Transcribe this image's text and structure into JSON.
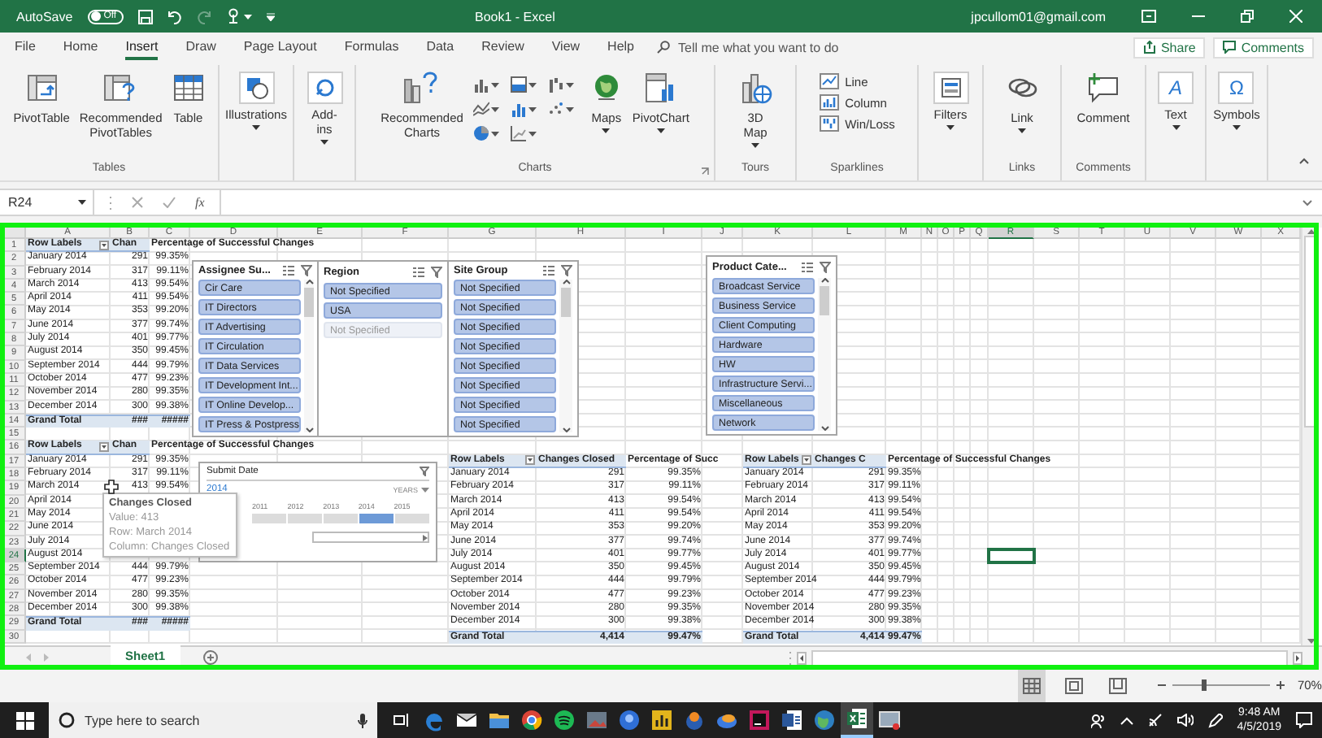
{
  "title_bar": {
    "autosave_label": "AutoSave",
    "autosave": {
      "label": "Off",
      "on": false
    },
    "quick_access": [
      {
        "kind": "save",
        "disabled": false
      },
      {
        "kind": "undo",
        "disabled": false
      },
      {
        "kind": "redo",
        "disabled": true
      },
      {
        "kind": "touch",
        "disabled": false
      }
    ],
    "title": "Book1 - Excel",
    "account": "jpcullom01@gmail.com"
  },
  "ribbon_tabs": [
    {
      "label": "File",
      "selected": false
    },
    {
      "label": "Home",
      "selected": false
    },
    {
      "label": "Insert",
      "selected": true
    },
    {
      "label": "Draw",
      "selected": false
    },
    {
      "label": "Page Layout",
      "selected": false
    },
    {
      "label": "Formulas",
      "selected": false
    },
    {
      "label": "Data",
      "selected": false
    },
    {
      "label": "Review",
      "selected": false
    },
    {
      "label": "View",
      "selected": false
    },
    {
      "label": "Help",
      "selected": false
    }
  ],
  "tell_me": {
    "placeholder": "Tell me what you want to do"
  },
  "share_button": "Share",
  "comments_button": "Comments",
  "ribbon_groups": [
    {
      "label": "Tables",
      "buttons": [
        {
          "kind": "pivottable",
          "label": "PivotTable"
        },
        {
          "kind": "recommended-pivot",
          "label": "Recommended PivotTables"
        },
        {
          "kind": "table",
          "label": "Table"
        }
      ]
    },
    {
      "buttons": [
        {
          "kind": "illustrations",
          "label": "Illustrations",
          "dropdown": true
        }
      ]
    },
    {
      "buttons": [
        {
          "kind": "addins",
          "label": "Add-ins",
          "dropdown": true
        }
      ]
    },
    {
      "label": "Charts",
      "launcher": true,
      "buttons": [
        {
          "kind": "recommended-charts",
          "label": "Recommended Charts"
        },
        {
          "kind": "chart-gallery"
        },
        {
          "kind": "maps",
          "label": "Maps",
          "dropdown": true
        },
        {
          "kind": "pivotchart",
          "label": "PivotChart",
          "dropdown": true
        }
      ]
    },
    {
      "label": "Tours",
      "buttons": [
        {
          "kind": "tours",
          "label": "3D Map",
          "dropdown": true
        }
      ]
    },
    {
      "label": "Sparklines",
      "buttons": [
        {
          "kind": "sparklines",
          "items": [
            {
              "kind": "line",
              "label": "Line"
            },
            {
              "kind": "column",
              "label": "Column"
            },
            {
              "kind": "winloss",
              "label": "Win/Loss"
            }
          ]
        }
      ]
    },
    {
      "buttons": [
        {
          "kind": "filters",
          "label": "Filters",
          "dropdown": true
        }
      ]
    },
    {
      "label": "Links",
      "buttons": [
        {
          "kind": "link",
          "label": "Link",
          "dropdown": true
        }
      ]
    },
    {
      "label": "Comments",
      "buttons": [
        {
          "kind": "comment",
          "label": "Comment"
        }
      ]
    },
    {
      "buttons": [
        {
          "kind": "text",
          "glyph": "A",
          "label": "Text",
          "dropdown": true
        }
      ]
    },
    {
      "buttons": [
        {
          "kind": "symbols",
          "glyph": "Ω",
          "label": "Symbols",
          "dropdown": true
        }
      ]
    }
  ],
  "formula_bar": {
    "name_box": "R24",
    "function_label": "fx"
  },
  "sheet": {
    "columns": [
      {
        "letter": "A",
        "selected": false
      },
      {
        "letter": "B",
        "selected": false
      },
      {
        "letter": "C",
        "selected": false
      },
      {
        "letter": "D",
        "selected": false
      },
      {
        "letter": "E",
        "selected": false
      },
      {
        "letter": "F",
        "selected": false
      },
      {
        "letter": "G",
        "selected": false
      },
      {
        "letter": "H",
        "selected": false
      },
      {
        "letter": "I",
        "selected": false
      },
      {
        "letter": "J",
        "selected": false
      },
      {
        "letter": "K",
        "selected": false
      },
      {
        "letter": "L",
        "selected": false
      },
      {
        "letter": "M",
        "selected": false
      },
      {
        "letter": "N",
        "selected": false
      },
      {
        "letter": "O",
        "selected": false
      },
      {
        "letter": "P",
        "selected": false
      },
      {
        "letter": "Q",
        "selected": false
      },
      {
        "letter": "R",
        "selected": true
      },
      {
        "letter": "S",
        "selected": false
      },
      {
        "letter": "T",
        "selected": false
      },
      {
        "letter": "U",
        "selected": false
      },
      {
        "letter": "V",
        "selected": false
      },
      {
        "letter": "W",
        "selected": false
      },
      {
        "letter": "X",
        "selected": false
      }
    ],
    "rows": [
      {
        "number": "1",
        "selected": false
      },
      {
        "number": "2",
        "selected": false
      },
      {
        "number": "3",
        "selected": false
      },
      {
        "number": "4",
        "selected": false
      },
      {
        "number": "5",
        "selected": false
      },
      {
        "number": "6",
        "selected": false
      },
      {
        "number": "7",
        "selected": false
      },
      {
        "number": "8",
        "selected": false
      },
      {
        "number": "9",
        "selected": false
      },
      {
        "number": "10",
        "selected": false
      },
      {
        "number": "11",
        "selected": false
      },
      {
        "number": "12",
        "selected": false
      },
      {
        "number": "13",
        "selected": false
      },
      {
        "number": "14",
        "selected": false
      },
      {
        "number": "15",
        "selected": false
      },
      {
        "number": "16",
        "selected": false
      },
      {
        "number": "17",
        "selected": false
      },
      {
        "number": "18",
        "selected": false
      },
      {
        "number": "19",
        "selected": false
      },
      {
        "number": "20",
        "selected": false
      },
      {
        "number": "21",
        "selected": false
      },
      {
        "number": "22",
        "selected": false
      },
      {
        "number": "23",
        "selected": false
      },
      {
        "number": "24",
        "selected": true
      },
      {
        "number": "25",
        "selected": false
      },
      {
        "number": "26",
        "selected": false
      },
      {
        "number": "27",
        "selected": false
      },
      {
        "number": "28",
        "selected": false
      },
      {
        "number": "29",
        "selected": false
      },
      {
        "number": "30",
        "selected": false
      }
    ]
  },
  "pivot_tables": [
    {
      "headers": [
        "Row Labels",
        "Chan",
        "Percentage of Successful Changes"
      ],
      "rows": [
        {
          "label": "January 2014",
          "count": "291",
          "percent": "99.35%"
        },
        {
          "label": "February 2014",
          "count": "317",
          "percent": "99.11%"
        },
        {
          "label": "March 2014",
          "count": "413",
          "percent": "99.54%"
        },
        {
          "label": "April 2014",
          "count": "411",
          "percent": "99.54%"
        },
        {
          "label": "May 2014",
          "count": "353",
          "percent": "99.20%"
        },
        {
          "label": "June 2014",
          "count": "377",
          "percent": "99.74%"
        },
        {
          "label": "July 2014",
          "count": "401",
          "percent": "99.77%"
        },
        {
          "label": "August 2014",
          "count": "350",
          "percent": "99.45%"
        },
        {
          "label": "September 2014",
          "count": "444",
          "percent": "99.79%"
        },
        {
          "label": "October 2014",
          "count": "477",
          "percent": "99.23%"
        },
        {
          "label": "November 2014",
          "count": "280",
          "percent": "99.35%"
        },
        {
          "label": "December 2014",
          "count": "300",
          "percent": "99.38%"
        }
      ],
      "total": {
        "label": "Grand Total",
        "count": "###",
        "percent": "#####"
      }
    },
    {
      "headers": [
        "Row Labels",
        "Chan",
        "Percentage of Successful Changes"
      ],
      "rows": [
        {
          "label": "January 2014",
          "count": "291",
          "percent": "99.35%"
        },
        {
          "label": "February 2014",
          "count": "317",
          "percent": "99.11%"
        },
        {
          "label": "March 2014",
          "count": "413",
          "percent": "99.54%"
        },
        {
          "label": "April 2014"
        },
        {
          "label": "May 2014"
        },
        {
          "label": "June 2014"
        },
        {
          "label": "July 2014"
        },
        {
          "label": "August 2014"
        },
        {
          "label": "September 2014",
          "count": "444",
          "percent": "99.79%"
        },
        {
          "label": "October 2014",
          "count": "477",
          "percent": "99.23%"
        },
        {
          "label": "November 2014",
          "count": "280",
          "percent": "99.35%"
        },
        {
          "label": "December 2014",
          "count": "300",
          "percent": "99.38%"
        }
      ],
      "total": {
        "label": "Grand Total",
        "count": "###",
        "percent": "#####"
      }
    },
    {
      "headers": [
        "Row Labels",
        "Changes Closed",
        "Percentage of Succ"
      ],
      "rows": [
        {
          "label": "January 2014",
          "count": "291",
          "percent": "99.35%"
        },
        {
          "label": "February 2014",
          "count": "317",
          "percent": "99.11%"
        },
        {
          "label": "March 2014",
          "count": "413",
          "percent": "99.54%"
        },
        {
          "label": "April 2014",
          "count": "411",
          "percent": "99.54%"
        },
        {
          "label": "May 2014",
          "count": "353",
          "percent": "99.20%"
        },
        {
          "label": "June 2014",
          "count": "377",
          "percent": "99.74%"
        },
        {
          "label": "July 2014",
          "count": "401",
          "percent": "99.77%"
        },
        {
          "label": "August 2014",
          "count": "350",
          "percent": "99.45%"
        },
        {
          "label": "September 2014",
          "count": "444",
          "percent": "99.79%"
        },
        {
          "label": "October 2014",
          "count": "477",
          "percent": "99.23%"
        },
        {
          "label": "November 2014",
          "count": "280",
          "percent": "99.35%"
        },
        {
          "label": "December 2014",
          "count": "300",
          "percent": "99.38%"
        }
      ],
      "total": {
        "label": "Grand Total",
        "count": "4,414",
        "percent": "99.47%"
      }
    },
    {
      "headers": [
        "Row Labels",
        "Changes C",
        "Percentage of Successful Changes"
      ],
      "rows": [
        {
          "label": "January 2014",
          "count": "291",
          "percent": "99.35%"
        },
        {
          "label": "February 2014",
          "count": "317",
          "percent": "99.11%"
        },
        {
          "label": "March 2014",
          "count": "413",
          "percent": "99.54%"
        },
        {
          "label": "April 2014",
          "count": "411",
          "percent": "99.54%"
        },
        {
          "label": "May 2014",
          "count": "353",
          "percent": "99.20%"
        },
        {
          "label": "June 2014",
          "count": "377",
          "percent": "99.74%"
        },
        {
          "label": "July 2014",
          "count": "401",
          "percent": "99.77%"
        },
        {
          "label": "August 2014",
          "count": "350",
          "percent": "99.45%"
        },
        {
          "label": "September 2014",
          "count": "444",
          "percent": "99.79%"
        },
        {
          "label": "October 2014",
          "count": "477",
          "percent": "99.23%"
        },
        {
          "label": "November 2014",
          "count": "280",
          "percent": "99.35%"
        },
        {
          "label": "December 2014",
          "count": "300",
          "percent": "99.38%"
        }
      ],
      "total": {
        "label": "Grand Total",
        "count": "4,414",
        "percent": "99.47%"
      }
    }
  ],
  "slicers": [
    {
      "title": "Assignee Su...",
      "scrollbar": true,
      "items": [
        {
          "label": "Cir Care",
          "selected": true
        },
        {
          "label": "IT Directors",
          "selected": true
        },
        {
          "label": "IT Advertising",
          "selected": true
        },
        {
          "label": "IT Circulation",
          "selected": true
        },
        {
          "label": "IT Data Services",
          "selected": true
        },
        {
          "label": "IT Development Int...",
          "selected": true
        },
        {
          "label": "IT Online Develop...",
          "selected": true
        },
        {
          "label": "IT Press & Postpress",
          "selected": true
        }
      ]
    },
    {
      "title": "Region",
      "scrollbar": false,
      "items": [
        {
          "label": "Not Specified",
          "selected": true
        },
        {
          "label": "USA",
          "selected": true
        },
        {
          "label": "Not Specified",
          "selected": false
        }
      ]
    },
    {
      "title": "Site Group",
      "scrollbar": true,
      "items": [
        {
          "label": "Not Specified",
          "selected": true
        },
        {
          "label": "Not Specified",
          "selected": true
        },
        {
          "label": "Not Specified",
          "selected": true
        },
        {
          "label": "Not Specified",
          "selected": true
        },
        {
          "label": "Not Specified",
          "selected": true
        },
        {
          "label": "Not Specified",
          "selected": true
        },
        {
          "label": "Not Specified",
          "selected": true
        },
        {
          "label": "Not Specified",
          "selected": true
        }
      ]
    },
    {
      "title": "Product Cate...",
      "scrollbar": true,
      "items": [
        {
          "label": "Broadcast Service",
          "selected": true
        },
        {
          "label": "Business Service",
          "selected": true
        },
        {
          "label": "Client Computing",
          "selected": true
        },
        {
          "label": "Hardware",
          "selected": true
        },
        {
          "label": "HW",
          "selected": true
        },
        {
          "label": "Infrastructure Servi...",
          "selected": true
        },
        {
          "label": "Miscellaneous",
          "selected": true
        },
        {
          "label": "Network",
          "selected": true
        }
      ]
    }
  ],
  "timeline": {
    "title": "Submit Date",
    "period": "2014",
    "level_label": "YEARS",
    "years": [
      {
        "label": "2011",
        "selected": false
      },
      {
        "label": "2012",
        "selected": false
      },
      {
        "label": "2013",
        "selected": false
      },
      {
        "label": "2014",
        "selected": true
      },
      {
        "label": "2015",
        "selected": false
      }
    ]
  },
  "tooltip": {
    "title": "Changes Closed",
    "lines": [
      "Value: 413",
      "Row: March 2014",
      "Column: Changes Closed"
    ]
  },
  "sheet_tabs": [
    {
      "label": "Sheet1",
      "selected": true
    }
  ],
  "status_bar": {
    "views": [
      {
        "kind": "normal",
        "selected": true
      },
      {
        "kind": "page-layout",
        "selected": false
      },
      {
        "kind": "page-break",
        "selected": false
      }
    ],
    "zoom": {
      "level": 0.32,
      "label": "70%"
    }
  },
  "taskbar": {
    "search": {
      "placeholder": "Type here to search"
    },
    "apps": [
      {
        "kind": "edge",
        "selected": false
      },
      {
        "kind": "mail",
        "selected": false
      },
      {
        "kind": "folder",
        "selected": false
      },
      {
        "kind": "chrome",
        "selected": false
      },
      {
        "kind": "music",
        "selected": false
      },
      {
        "kind": "photo",
        "selected": false
      },
      {
        "kind": "bluecircle",
        "selected": false
      },
      {
        "kind": "chart",
        "selected": false
      },
      {
        "kind": "orange",
        "selected": false
      },
      {
        "kind": "bird",
        "selected": false
      },
      {
        "kind": "ide",
        "selected": false
      },
      {
        "kind": "word",
        "selected": false
      },
      {
        "kind": "globe",
        "selected": false
      },
      {
        "kind": "excel",
        "selected": true
      },
      {
        "kind": "screen",
        "selected": false
      }
    ],
    "time": "9:48 AM",
    "date": "4/5/2019"
  }
}
